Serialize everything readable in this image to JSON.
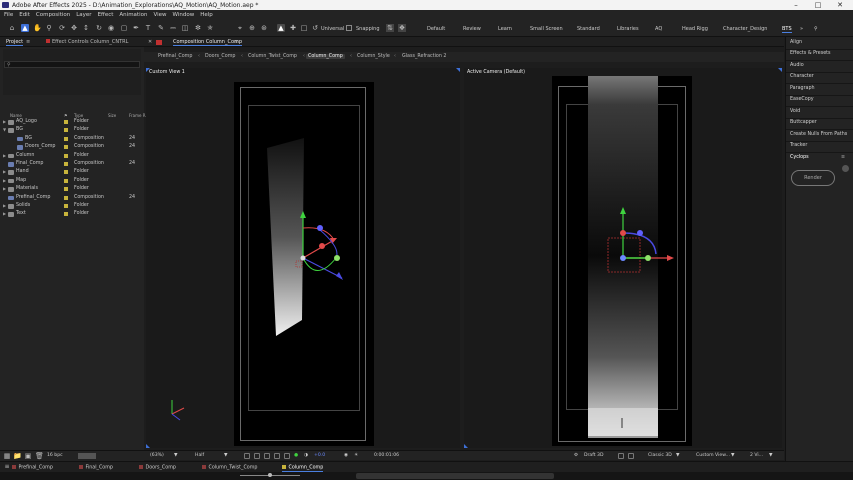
{
  "titlebar": {
    "title": "Adobe After Effects 2025 - D:\\Animation_Explorations\\AQ_Motion\\AQ_Motion.aep *"
  },
  "menu": [
    "File",
    "Edit",
    "Composition",
    "Layer",
    "Effect",
    "Animation",
    "View",
    "Window",
    "Help"
  ],
  "toolbar": {
    "universal_label": "Universal",
    "snapping_label": "Snapping",
    "workspaces": [
      "Default",
      "Review",
      "Learn",
      "Small Screen",
      "Standard",
      "Libraries",
      "AQ",
      "Head Rigg",
      "Character_Design",
      "BTS"
    ],
    "active_workspace": "BTS"
  },
  "project_panel": {
    "tab_project": "Project",
    "tab_effect_controls": "Effect Controls Column_CNTRL",
    "columns": {
      "name": "Name",
      "type": "Type",
      "size": "Size",
      "frame_rate": "Frame R..."
    },
    "items": [
      {
        "name": "AQ_Logo",
        "type": "Folder",
        "fr": "",
        "kind": "folder",
        "expanded": false,
        "sub": false,
        "color": "#c8b43c"
      },
      {
        "name": "BG",
        "type": "Folder",
        "fr": "",
        "kind": "folder",
        "expanded": true,
        "sub": false,
        "color": "#c8b43c"
      },
      {
        "name": "BG",
        "type": "Composition",
        "fr": "24",
        "kind": "comp",
        "expanded": false,
        "sub": true,
        "color": "#c8b43c"
      },
      {
        "name": "Doors_Comp",
        "type": "Composition",
        "fr": "24",
        "kind": "comp",
        "expanded": false,
        "sub": true,
        "color": "#c8b43c"
      },
      {
        "name": "Column",
        "type": "Folder",
        "fr": "",
        "kind": "folder",
        "expanded": false,
        "sub": false,
        "color": "#c8b43c"
      },
      {
        "name": "Final_Comp",
        "type": "Composition",
        "fr": "24",
        "kind": "comp",
        "expanded": false,
        "sub": false,
        "color": "#c8b43c"
      },
      {
        "name": "Hand",
        "type": "Folder",
        "fr": "",
        "kind": "folder",
        "expanded": false,
        "sub": false,
        "color": "#c8b43c"
      },
      {
        "name": "Map",
        "type": "Folder",
        "fr": "",
        "kind": "folder",
        "expanded": false,
        "sub": false,
        "color": "#c8b43c"
      },
      {
        "name": "Materials",
        "type": "Folder",
        "fr": "",
        "kind": "folder",
        "expanded": false,
        "sub": false,
        "color": "#c8b43c"
      },
      {
        "name": "Prefinal_Comp",
        "type": "Composition",
        "fr": "24",
        "kind": "comp",
        "expanded": false,
        "sub": false,
        "color": "#c8b43c"
      },
      {
        "name": "Solids",
        "type": "Folder",
        "fr": "",
        "kind": "folder",
        "expanded": false,
        "sub": false,
        "color": "#c8b43c"
      },
      {
        "name": "Text",
        "type": "Folder",
        "fr": "",
        "kind": "folder",
        "expanded": false,
        "sub": false,
        "color": "#c8b43c"
      }
    ],
    "bpc": "16 bpc"
  },
  "composition": {
    "header": "Composition Column_Comp",
    "tabs": [
      "Prefinal_Comp",
      "Doors_Comp",
      "Column_Twist_Comp",
      "Column_Comp",
      "Column_Style",
      "Glass_Refraction 2"
    ],
    "active_tab": "Column_Comp",
    "left_view_label": "Custom View 1",
    "right_view_label": "Active Camera (Default)"
  },
  "viewer_bar": {
    "zoom": "(63%)",
    "resolution": "Half",
    "exposure": "+0.0",
    "timecode": "0:00:01:06",
    "draft": "Draft 3D",
    "renderer": "Classic 3D",
    "view": "Custom View...",
    "views": "2 Vi..."
  },
  "right_panel": {
    "items": [
      "Align",
      "Effects & Presets",
      "Audio",
      "Character",
      "Paragraph",
      "EaseCopy",
      "Void",
      "Buttcapper",
      "Create Nulls From Paths",
      "Tracker",
      "Cyclops"
    ],
    "render_label": "Render"
  },
  "bottom_tabs": [
    {
      "label": "Prefinal_Comp",
      "color": "#8a3a3a"
    },
    {
      "label": "Final_Comp",
      "color": "#8a3a3a"
    },
    {
      "label": "Doors_Comp",
      "color": "#8a3a3a"
    },
    {
      "label": "Column_Twist_Comp",
      "color": "#8a3a3a"
    },
    {
      "label": "Column_Comp",
      "color": "#c8b43c"
    }
  ],
  "active_bottom_tab": "Column_Comp",
  "colors": {
    "accent": "#3d6fd6",
    "gizmo_x": "#e24a4a",
    "gizmo_y": "#3fd33f",
    "gizmo_z": "#4a4ae2",
    "folder": "#c8b43c"
  }
}
